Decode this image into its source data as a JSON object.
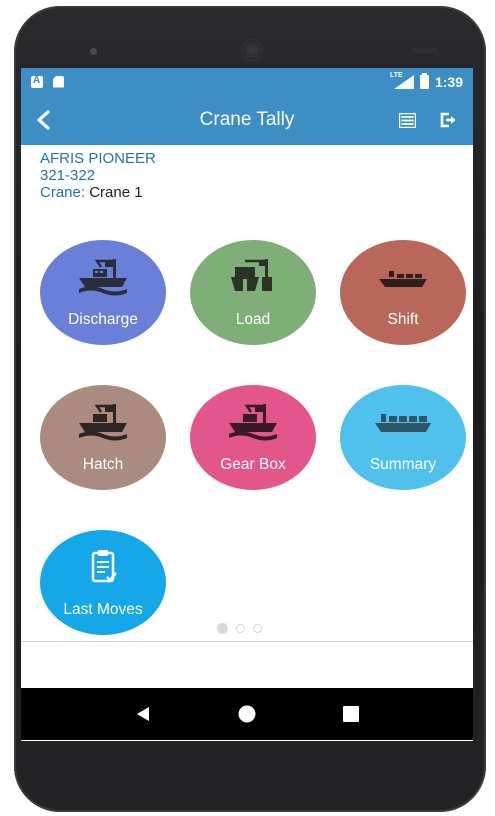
{
  "status_bar": {
    "network": "LTE",
    "time": "1:39"
  },
  "app_bar": {
    "title": "Crane Tally"
  },
  "vessel": {
    "name": "AFRIS PIONEER",
    "code": "321-322",
    "crane_label": "Crane:",
    "crane_value": "Crane 1"
  },
  "tiles": [
    {
      "label": "Discharge",
      "color": "#6a7fd8",
      "icon": "ship-crane-icon"
    },
    {
      "label": "Load",
      "color": "#7fae78",
      "icon": "ship-load-icon"
    },
    {
      "label": "Shift",
      "color": "#b9675a",
      "icon": "cargo-ship-icon"
    },
    {
      "label": "Hatch",
      "color": "#ab8a80",
      "icon": "ship-crane-icon"
    },
    {
      "label": "Gear Box",
      "color": "#e3568c",
      "icon": "ship-crane-icon"
    },
    {
      "label": "Summary",
      "color": "#4fc1ec",
      "icon": "container-ship-icon"
    },
    {
      "label": "Last Moves",
      "color": "#15a7e8",
      "icon": "clipboard-check-icon"
    }
  ],
  "pager": {
    "pages": 3,
    "current": 1
  },
  "colors": {
    "primary": "#3d8ec4",
    "link_text": "#2b6fb0"
  }
}
